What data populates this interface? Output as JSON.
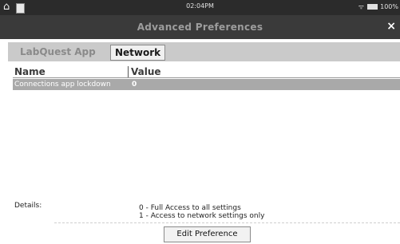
{
  "status_bar": {
    "time": "02:04PM",
    "battery": "100%"
  },
  "window": {
    "title": "Advanced Preferences",
    "close_label": "×"
  },
  "tabs": [
    {
      "label": "LabQuest App",
      "active": false
    },
    {
      "label": "Network",
      "active": true
    }
  ],
  "table": {
    "columns": [
      "Name",
      "Value"
    ],
    "rows": [
      {
        "name": "Connections app lockdown",
        "value": "0",
        "selected": true
      }
    ]
  },
  "details": {
    "label": "Details:",
    "lines": [
      "0 - Full Access to all settings",
      "1 - Access to network settings only"
    ]
  },
  "actions": {
    "edit_label": "Edit Preference"
  },
  "icons": {
    "home": "home-icon",
    "document": "document-icon",
    "wifi": "wifi-icon",
    "battery": "battery-icon",
    "close": "close-icon"
  },
  "colors": {
    "status_bar_bg": "#2b2b2b",
    "title_bar_bg": "#3a3a3a",
    "tab_bar_bg": "#cacaca",
    "selected_row_bg": "#a9a9a9"
  }
}
